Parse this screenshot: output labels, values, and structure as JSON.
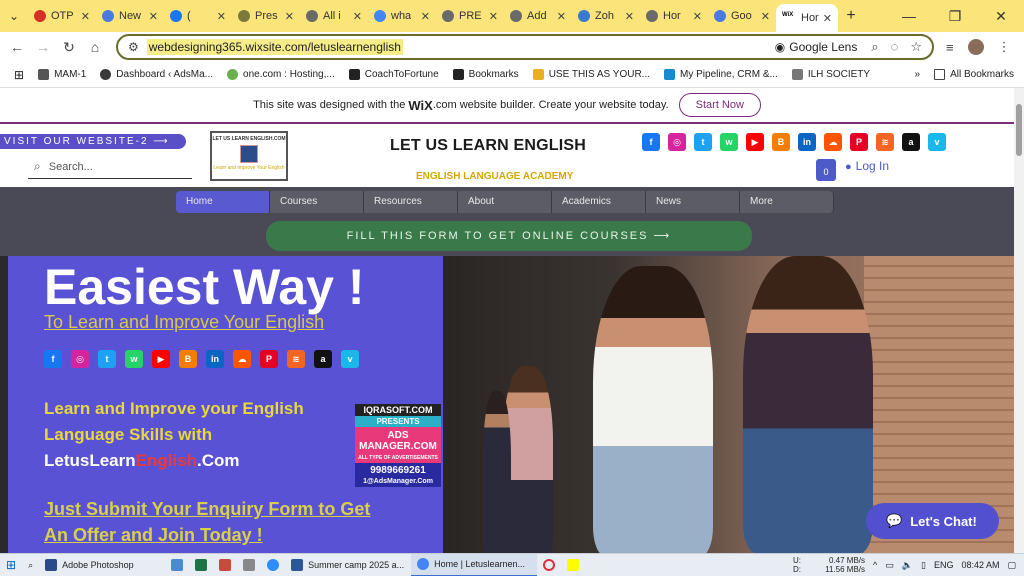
{
  "browser": {
    "tabs": [
      {
        "label": "OTP",
        "color": "#d93025"
      },
      {
        "label": "New",
        "color": "#4a7adf"
      },
      {
        "label": "(",
        "color": "#1877f2"
      },
      {
        "label": "Pres",
        "color": "#7a7a3a"
      },
      {
        "label": "All i",
        "color": "#6a6a6a"
      },
      {
        "label": "wha",
        "color": "#4285f4"
      },
      {
        "label": "PRE",
        "color": "#6a6a6a"
      },
      {
        "label": "Add",
        "color": "#6a6a6a"
      },
      {
        "label": "Zoh",
        "color": "#3a7ad0"
      },
      {
        "label": "Hor",
        "color": "#6a6a6a"
      },
      {
        "label": "Goo",
        "color": "#4a7adf"
      },
      {
        "label": "Hor",
        "color": "#222222"
      }
    ],
    "active_tab_icon": "WiX",
    "url": "webdesigning365.wixsite.com/letuslearnenglish",
    "lens_label": "Google Lens",
    "bookmarks": [
      {
        "label": "MAM-1",
        "icon": "folder-icon"
      },
      {
        "label": "Dashboard ‹ AdsMa...",
        "icon": "wordpress-icon"
      },
      {
        "label": "one.com : Hosting,...",
        "icon": "globe-icon"
      },
      {
        "label": "CoachToFortune",
        "icon": "logo-icon"
      },
      {
        "label": "Bookmarks",
        "icon": "star-icon"
      },
      {
        "label": "USE THIS AS YOUR...",
        "icon": "bookmark-icon"
      },
      {
        "label": "My Pipeline, CRM &...",
        "icon": "crm-icon"
      },
      {
        "label": "ILH SOCIETY",
        "icon": "society-icon"
      }
    ],
    "all_bookmarks_label": "All Bookmarks"
  },
  "wix_banner": {
    "text_before": "This site was designed with the",
    "wix": "WiX",
    "text_after": ".com website builder. Create your website today.",
    "start_now": "Start Now"
  },
  "header": {
    "visit_button": "VISIT OUR WEBSITE-2",
    "search_placeholder": "Search...",
    "logo_text": "LET US LEARN ENGLISH.COM",
    "logo_tagline": "Learn and Improve Your English",
    "site_title": "LET US LEARN ENGLISH",
    "site_subtitle": "ENGLISH LANGUAGE ACADEMY",
    "cart_count": "0",
    "login": "Log In"
  },
  "social": [
    {
      "name": "facebook-icon",
      "color": "#1877f2",
      "glyph": "f"
    },
    {
      "name": "instagram-icon",
      "color": "#d6249f",
      "glyph": "◎"
    },
    {
      "name": "twitter-icon",
      "color": "#1da1f2",
      "glyph": "t"
    },
    {
      "name": "whatsapp-icon",
      "color": "#25d366",
      "glyph": "w"
    },
    {
      "name": "youtube-icon",
      "color": "#ff0000",
      "glyph": "▶"
    },
    {
      "name": "blogger-icon",
      "color": "#f57d00",
      "glyph": "B"
    },
    {
      "name": "linkedin-icon",
      "color": "#0a66c2",
      "glyph": "in"
    },
    {
      "name": "soundcloud-icon",
      "color": "#ff5500",
      "glyph": "☁"
    },
    {
      "name": "pinterest-icon",
      "color": "#e60023",
      "glyph": "P"
    },
    {
      "name": "rss-icon",
      "color": "#f26522",
      "glyph": "≋"
    },
    {
      "name": "amazon-icon",
      "color": "#111111",
      "glyph": "a"
    },
    {
      "name": "vimeo-icon",
      "color": "#1ab7ea",
      "glyph": "v"
    }
  ],
  "nav": {
    "items": [
      "Home",
      "Courses",
      "Resources",
      "About",
      "Academics",
      "News",
      "More"
    ],
    "form_button": "FILL THIS FORM TO GET ONLINE COURSES"
  },
  "hero": {
    "title": "Easiest Way !",
    "subtitle": "To Learn and Improve Your English",
    "body_line1": "Learn and Improve your English",
    "body_line2": "Language Skills with",
    "brand_part1": "Letus",
    "brand_part2": "Learn",
    "brand_part3": "English",
    "brand_part4": ".Com",
    "enquiry_line1": "Just Submit Your Enquiry Form to Get",
    "enquiry_line2": "An Offer and Join Today !"
  },
  "ad": {
    "line1": "IQRASOFT.COM",
    "line2": "PRESENTS",
    "line3": "ADS MANAGER.COM",
    "line4": "ALL TYPE OF ADVERTISEMENTS",
    "line5": "9989669261",
    "line6": "1@AdsManager.Com"
  },
  "chat": {
    "label": "Let's Chat!"
  },
  "taskbar": {
    "apps": [
      {
        "label": "Adobe Photoshop",
        "color": "#2a4a8a"
      },
      {
        "label": "Summer camp 2025 a...",
        "color": "#2b579a"
      },
      {
        "label": "Home | Letuslearnen...",
        "color": "#4285f4"
      }
    ],
    "net_up": "0.47 MB/s",
    "net_down": "11.56 MB/s",
    "net_up_label": "U:",
    "net_down_label": "D:",
    "lang": "ENG",
    "time": "08:42 AM"
  }
}
